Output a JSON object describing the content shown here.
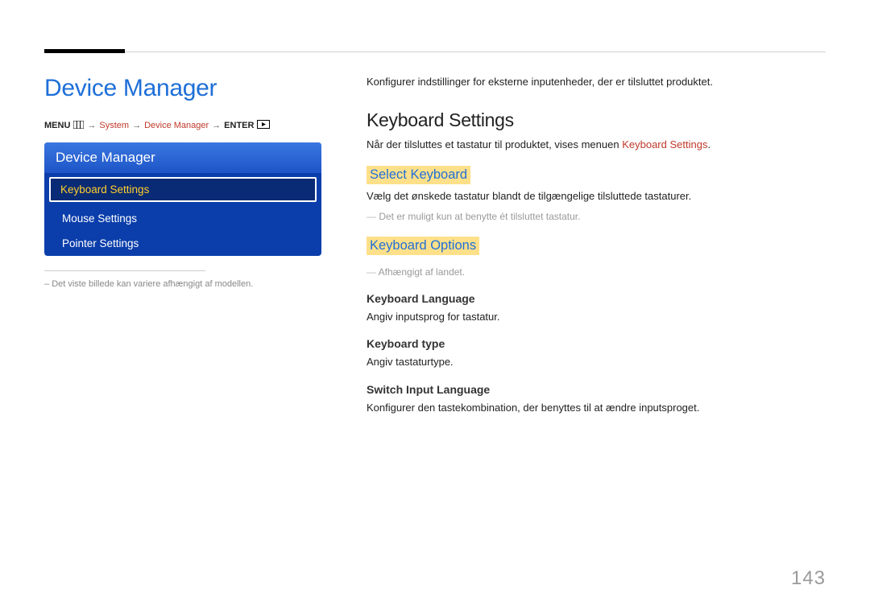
{
  "left": {
    "title": "Device Manager",
    "breadcrumb": {
      "menu": "MENU",
      "system": "System",
      "device_manager": "Device Manager",
      "enter": "ENTER"
    },
    "menu": {
      "header": "Device Manager",
      "items": [
        {
          "label": "Keyboard Settings",
          "selected": true
        },
        {
          "label": "Mouse Settings",
          "selected": false
        },
        {
          "label": "Pointer Settings",
          "selected": false
        }
      ]
    },
    "footnote_prefix": "–  ",
    "footnote": "Det viste billede kan variere afhængigt af modellen."
  },
  "right": {
    "intro": "Konfigurer indstillinger for eksterne inputenheder, der er tilsluttet produktet.",
    "section_title": "Keyboard Settings",
    "section_desc_pre": "Når der tilsluttes et tastatur til produktet, vises menuen ",
    "section_desc_accent": "Keyboard Settings",
    "section_desc_post": ".",
    "select_kb": {
      "title": "Select Keyboard",
      "desc": "Vælg det ønskede tastatur blandt de tilgængelige tilsluttede tastaturer.",
      "note": "Det er muligt kun at benytte ét tilsluttet tastatur."
    },
    "kb_options": {
      "title": "Keyboard Options",
      "note": "Afhængigt af landet.",
      "lang": {
        "title": "Keyboard Language",
        "desc": "Angiv inputsprog for tastatur."
      },
      "type": {
        "title": "Keyboard type",
        "desc": "Angiv tastaturtype."
      },
      "switch": {
        "title": "Switch Input Language",
        "desc": "Konfigurer den tastekombination, der benyttes til at ændre inputsproget."
      }
    }
  },
  "page_number": "143"
}
